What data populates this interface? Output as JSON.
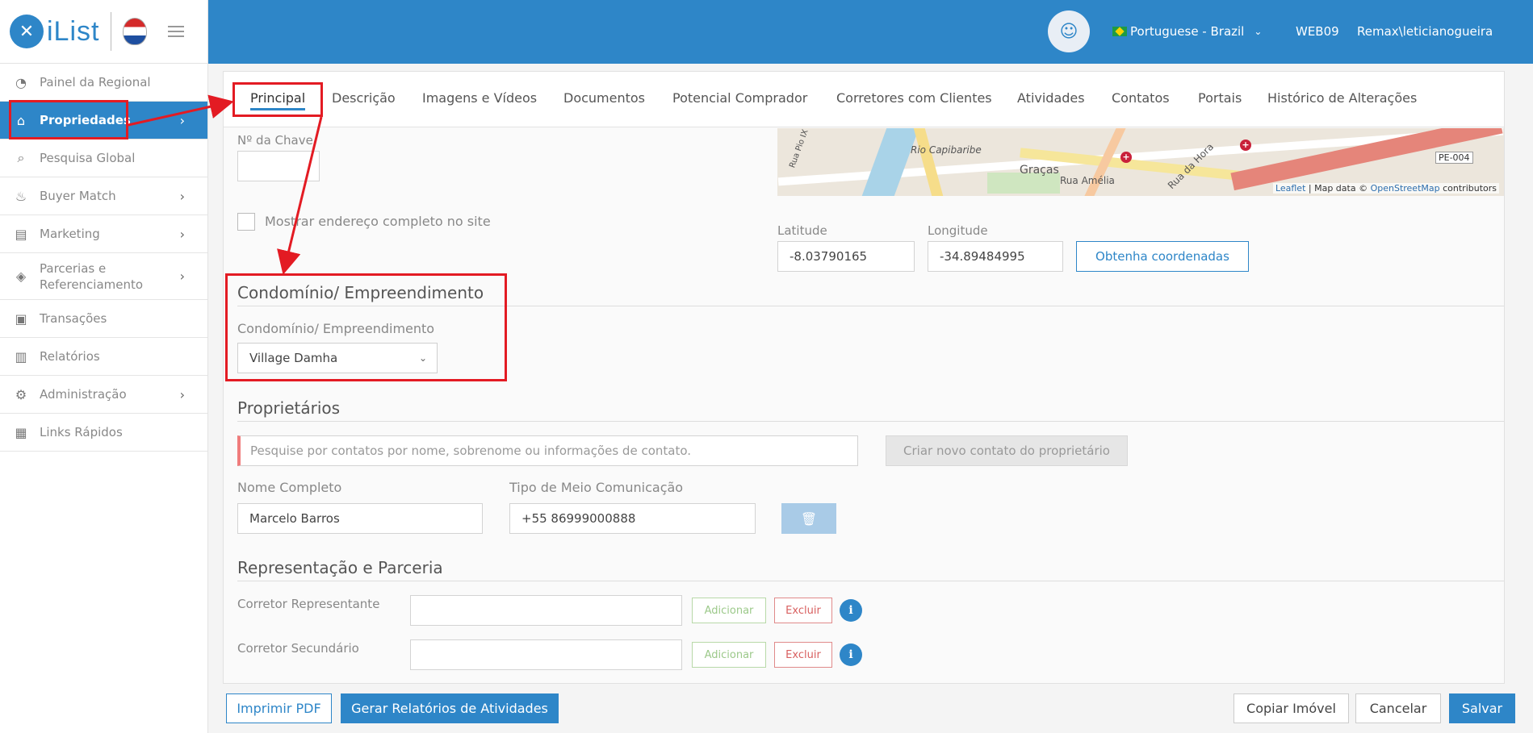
{
  "brand": {
    "logo_text": "iList",
    "partner_icon": "remax-balloon-icon"
  },
  "sidebar": {
    "items": [
      {
        "label": "Painel da Regional",
        "icon": "gauge-icon",
        "chevron": false
      },
      {
        "label": "Propriedades",
        "icon": "home-icon",
        "chevron": true,
        "active": true
      },
      {
        "label": "Pesquisa Global",
        "icon": "search-icon",
        "chevron": false
      },
      {
        "label": "Buyer Match",
        "icon": "flame-icon",
        "chevron": true
      },
      {
        "label": "Marketing",
        "icon": "book-icon",
        "chevron": true
      },
      {
        "label_line1": "Parcerias e",
        "label_line2": "Referenciamento",
        "icon": "tag-icon",
        "chevron": true
      },
      {
        "label": "Transações",
        "icon": "briefcase-icon",
        "chevron": false
      },
      {
        "label": "Relatórios",
        "icon": "bar-chart-icon",
        "chevron": false
      },
      {
        "label": "Administração",
        "icon": "gear-icon",
        "chevron": true
      },
      {
        "label": "Links Rápidos",
        "icon": "building-icon",
        "chevron": false
      }
    ]
  },
  "topbar": {
    "language": "Portuguese - Brazil",
    "office": "WEB09",
    "user": "Remax\\leticianogueira"
  },
  "tabs": [
    "Principal",
    "Descrição",
    "Imagens e Vídeos",
    "Documentos",
    "Potencial Comprador",
    "Corretores com Clientes",
    "Atividades",
    "Contatos",
    "Portais",
    "Histórico de Alterações"
  ],
  "key_field": {
    "label": "Nº da Chave",
    "value": ""
  },
  "show_address": {
    "label": "Mostrar endereço completo no site"
  },
  "map": {
    "labels": [
      "Rio Capibaribe",
      "Graças",
      "Rua Amélia",
      "Rua da Hora",
      "Rua Pio IX"
    ],
    "road_sign": "PE-004",
    "attribution_leaflet": "Leaflet",
    "attribution_mid": " | Map data © ",
    "attribution_osm": "OpenStreetMap",
    "attribution_end": " contributors"
  },
  "coords": {
    "latitude_label": "Latitude",
    "latitude_value": "-8.03790165",
    "longitude_label": "Longitude",
    "longitude_value": "-34.89484995",
    "button": "Obtenha coordenadas"
  },
  "condominio": {
    "section_title": "Condomínio/ Empreendimento",
    "field_label": "Condomínio/ Empreendimento",
    "selected": "Village Damha"
  },
  "proprietarios": {
    "section_title": "Proprietários",
    "search_placeholder": "Pesquise por contatos por nome, sobrenome ou informações de contato.",
    "create_button": "Criar novo contato do proprietário",
    "name_label": "Nome Completo",
    "name_value": "Marcelo Barros",
    "comm_label": "Tipo de Meio Comunicação",
    "comm_value": "+55 86999000888"
  },
  "representacao": {
    "section_title": "Representação e Parceria",
    "rows": [
      {
        "label": "Corretor Representante",
        "add": "Adicionar",
        "remove": "Excluir"
      },
      {
        "label": "Corretor Secundário",
        "add": "Adicionar",
        "remove": "Excluir"
      }
    ]
  },
  "footer": {
    "print_pdf": "Imprimir PDF",
    "activity_report": "Gerar Relatórios de Atividades",
    "copy": "Copiar Imóvel",
    "cancel": "Cancelar",
    "save": "Salvar"
  },
  "colors": {
    "primary": "#2e86c8",
    "annotation": "#e31b23"
  }
}
